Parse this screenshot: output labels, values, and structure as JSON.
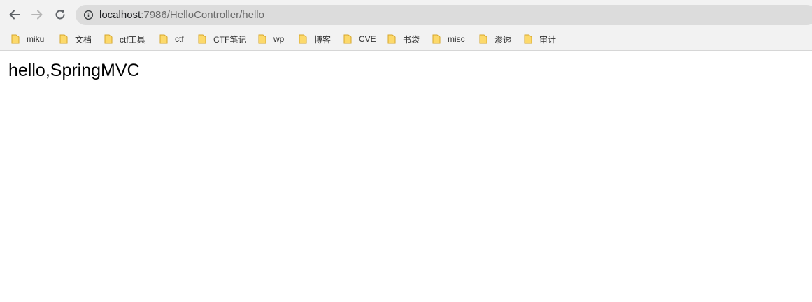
{
  "browser": {
    "address_bar": {
      "host": "localhost",
      "path": ":7986/HelloController/hello",
      "info_icon": "info-icon"
    },
    "nav": {
      "back_icon": "arrow-left-icon",
      "forward_icon": "arrow-right-icon",
      "reload_icon": "reload-icon"
    },
    "bookmarks": [
      {
        "label": "miku",
        "icon": "folder-icon"
      },
      {
        "label": "文档",
        "icon": "folder-icon"
      },
      {
        "label": "ctf工具",
        "icon": "folder-icon"
      },
      {
        "label": "ctf",
        "icon": "folder-icon"
      },
      {
        "label": "CTF笔记",
        "icon": "folder-icon"
      },
      {
        "label": "wp",
        "icon": "folder-icon"
      },
      {
        "label": "博客",
        "icon": "folder-icon"
      },
      {
        "label": "CVE",
        "icon": "folder-icon"
      },
      {
        "label": "书袋",
        "icon": "folder-icon"
      },
      {
        "label": "misc",
        "icon": "folder-icon"
      },
      {
        "label": "渗透",
        "icon": "folder-icon"
      },
      {
        "label": "审计",
        "icon": "folder-icon"
      }
    ]
  },
  "page": {
    "body_text": "hello,SpringMVC"
  },
  "colors": {
    "chrome_bg": "#f2f2f2",
    "omnibox_bg": "#dcdcdc",
    "folder_fill": "#fcd96b",
    "folder_stroke": "#d7a72b"
  }
}
